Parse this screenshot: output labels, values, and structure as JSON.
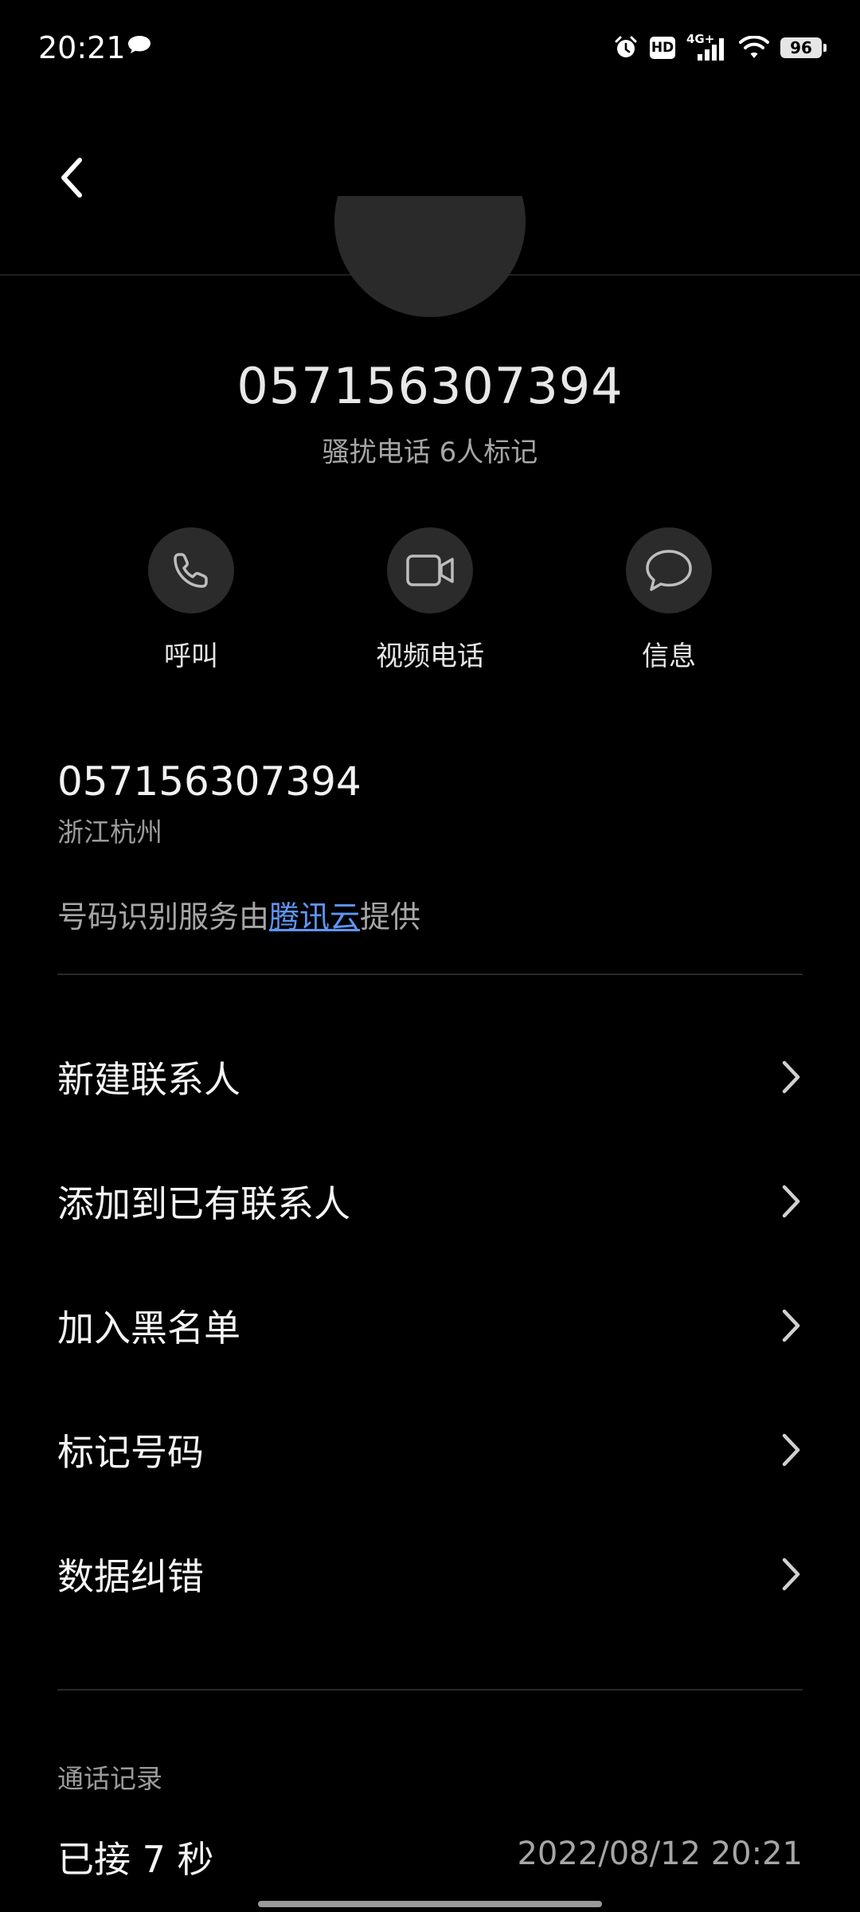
{
  "status_bar": {
    "time": "20:21",
    "chat_icon": "chat-bubble-icon",
    "icons": [
      "alarm-icon",
      "hd-icon",
      "signal-4g-icon",
      "wifi-icon"
    ],
    "network_label": "4G+",
    "hd_label": "HD",
    "battery": "96"
  },
  "header": {
    "back_icon": "chevron-left-icon"
  },
  "caller": {
    "number": "057156307394",
    "tag": "骚扰电话 6人标记"
  },
  "actions": [
    {
      "label": "呼叫",
      "icon": "phone-icon"
    },
    {
      "label": "视频电话",
      "icon": "video-camera-icon"
    },
    {
      "label": "信息",
      "icon": "message-bubble-icon"
    }
  ],
  "number_info": {
    "number": "057156307394",
    "location": "浙江杭州",
    "provider_prefix": "号码识别服务由",
    "provider_link": "腾讯云",
    "provider_suffix": "提供"
  },
  "menu": [
    {
      "label": "新建联系人"
    },
    {
      "label": "添加到已有联系人"
    },
    {
      "label": "加入黑名单"
    },
    {
      "label": "标记号码"
    },
    {
      "label": "数据纠错"
    }
  ],
  "call_log": {
    "title": "通话记录",
    "status": "已接 7 秒",
    "datetime": "2022/08/12  20:21"
  },
  "colors": {
    "background": "#000000",
    "link": "#5f95f3",
    "button_circle": "#2b2b2b",
    "secondary_text": "#a6a6a6"
  }
}
